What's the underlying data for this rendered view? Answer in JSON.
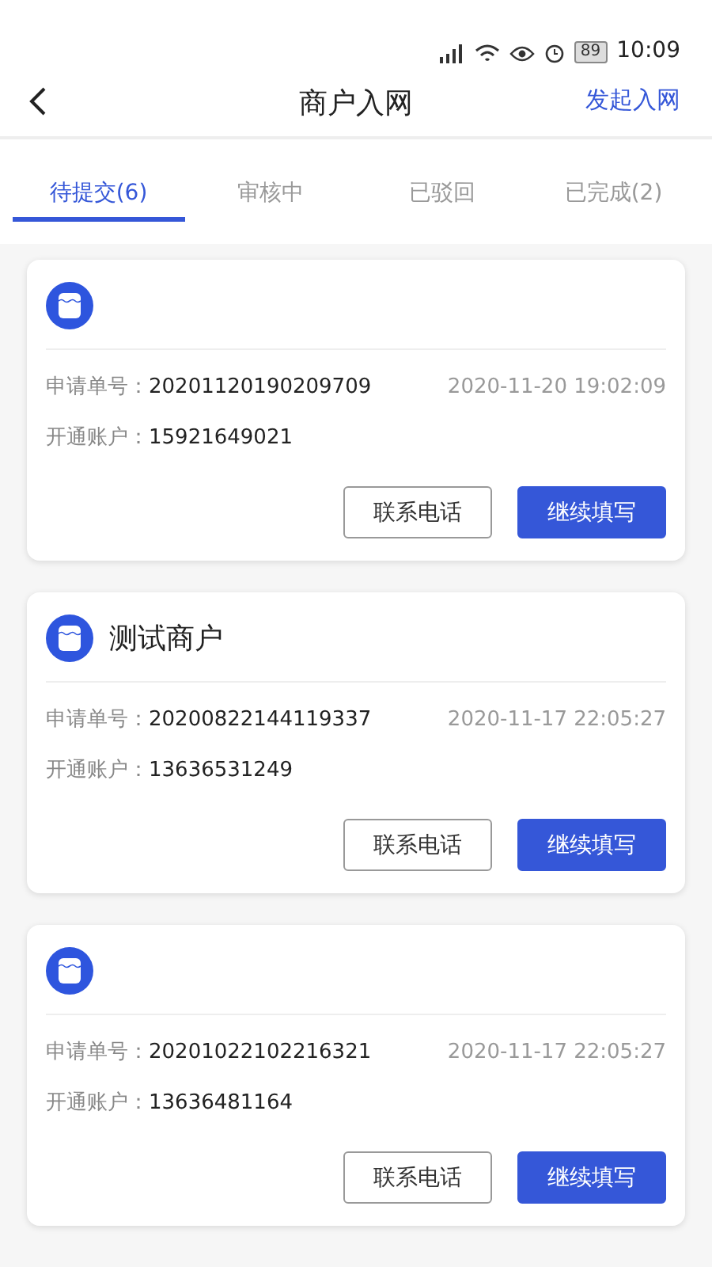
{
  "status_bar": {
    "time": "10:09",
    "battery": "89"
  },
  "header": {
    "title": "商户入网",
    "action": "发起入网"
  },
  "tabs": [
    {
      "label": "待提交(6)",
      "selected": true
    },
    {
      "label": "审核中",
      "selected": false
    },
    {
      "label": "已驳回",
      "selected": false
    },
    {
      "label": "已完成(2)",
      "selected": false
    }
  ],
  "cards": [
    {
      "order_label": "申请单号：",
      "order_no": "20201120190209709",
      "time": "2020-11-20 19:02:09",
      "account_label": "开通账户：",
      "account": "15921649021",
      "buttons": [
        "联系电话",
        "继续填写"
      ]
    },
    {
      "name": "测试商户",
      "order_label": "申请单号：",
      "order_no": "20200822144119337",
      "time": "2020-11-17 22:05:27",
      "account_label": "开通账户：",
      "account": "13636531249",
      "buttons": [
        "联系电话",
        "继续填写"
      ]
    },
    {
      "order_label": "申请单号：",
      "order_no": "20201022102216321",
      "time": "2020-11-17 22:05:27",
      "account_label": "开通账户：",
      "account": "13636481164",
      "buttons": [
        "联系电话",
        "继续填写"
      ]
    }
  ]
}
